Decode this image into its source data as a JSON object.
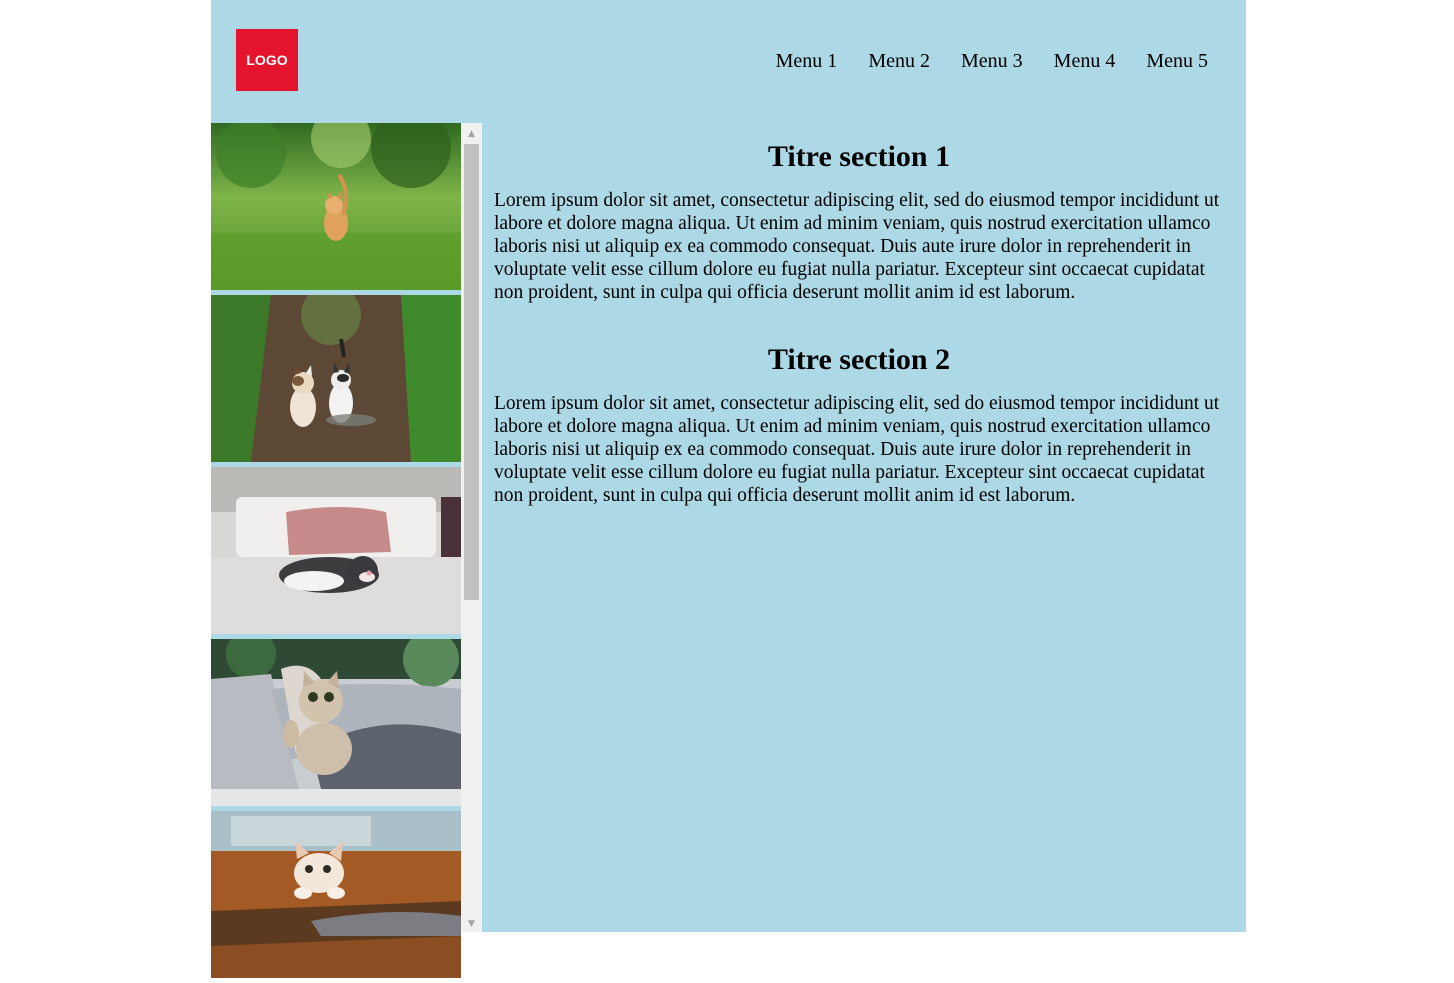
{
  "header": {
    "logo_text": "LOGO",
    "logo_color": "#e5142e",
    "nav": [
      "Menu 1",
      "Menu 2",
      "Menu 3",
      "Menu 4",
      "Menu 5"
    ]
  },
  "sidebar": {
    "images": [
      {
        "icon": "kitten-in-grass"
      },
      {
        "icon": "two-kittens-on-path"
      },
      {
        "icon": "sleeping-cat-on-bed"
      },
      {
        "icon": "kitten-on-sofa"
      },
      {
        "icon": "kitten-on-table"
      }
    ]
  },
  "sections": [
    {
      "title": "Titre section 1",
      "body": "Lorem ipsum dolor sit amet, consectetur adipiscing elit, sed do eiusmod tempor incididunt ut labore et dolore magna aliqua. Ut enim ad minim veniam, quis nostrud exercitation ullamco laboris nisi ut aliquip ex ea commodo consequat. Duis aute irure dolor in reprehenderit in voluptate velit esse cillum dolore eu fugiat nulla pariatur. Excepteur sint occaecat cupidatat non proident, sunt in culpa qui officia deserunt mollit anim id est laborum."
    },
    {
      "title": "Titre section 2",
      "body": "Lorem ipsum dolor sit amet, consectetur adipiscing elit, sed do eiusmod tempor incididunt ut labore et dolore magna aliqua. Ut enim ad minim veniam, quis nostrud exercitation ullamco laboris nisi ut aliquip ex ea commodo consequat. Duis aute irure dolor in reprehenderit in voluptate velit esse cillum dolore eu fugiat nulla pariatur. Excepteur sint occaecat cupidatat non proident, sunt in culpa qui officia deserunt mollit anim id est laborum."
    }
  ],
  "colors": {
    "page_background": "#add8e6",
    "outer_background": "#ffffff"
  }
}
